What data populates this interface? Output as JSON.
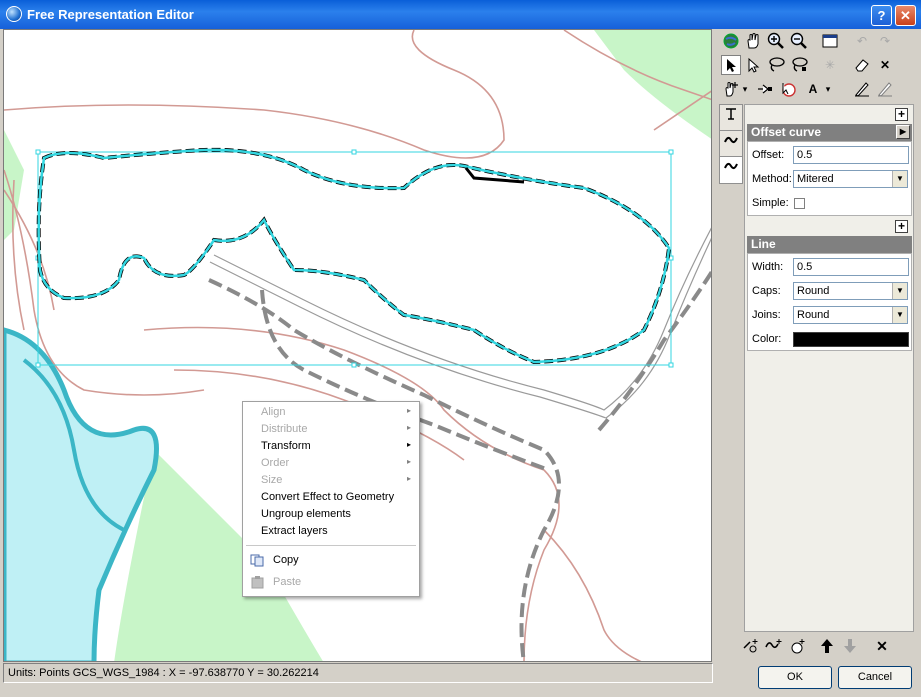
{
  "window": {
    "title": "Free Representation Editor",
    "help_label": "?",
    "close_label": "✕"
  },
  "context_menu": {
    "items": [
      {
        "label": "Align",
        "enabled": false,
        "submenu": true
      },
      {
        "label": "Distribute",
        "enabled": false,
        "submenu": true
      },
      {
        "label": "Transform",
        "enabled": true,
        "submenu": true
      },
      {
        "label": "Order",
        "enabled": false,
        "submenu": true
      },
      {
        "label": "Size",
        "enabled": false,
        "submenu": true
      },
      {
        "label": "Convert Effect to Geometry",
        "enabled": true,
        "submenu": false
      },
      {
        "label": "Ungroup elements",
        "enabled": true,
        "submenu": false
      },
      {
        "label": "Extract layers",
        "enabled": true,
        "submenu": false
      }
    ],
    "copy_label": "Copy",
    "paste_label": "Paste",
    "submenu_glyph": "▸"
  },
  "toolbar": {
    "row1": [
      "globe-icon",
      "pan-hand-icon",
      "zoom-in-icon",
      "zoom-out-icon",
      "full-extent-icon",
      "undo-icon",
      "redo-icon"
    ],
    "row2": [
      "select-arrow-icon",
      "direct-select-icon",
      "lasso-icon",
      "lasso-vertex-icon",
      "sparkle-icon",
      "eraser-icon",
      "delete-x-icon"
    ],
    "row3": [
      "add-vertex-icon",
      "dropdown-arrow-icon",
      "reshape-icon",
      "marker-icon",
      "text-a-icon",
      "dropdown-arrow-icon",
      "pen-icon",
      "pen-alt-icon"
    ],
    "glyphs": {
      "undo": "↶",
      "redo": "↷",
      "delete": "✕",
      "sparkle": "✳",
      "text": "A",
      "dropdown": "▾",
      "pointer": "➤",
      "hollow_pointer": "▷"
    }
  },
  "vtabs": [
    "layer-icon",
    "curve-icon",
    "curve-active-icon"
  ],
  "panel": {
    "offset_section": {
      "title": "Offset curve",
      "offset_label": "Offset:",
      "offset_value": "0.5",
      "method_label": "Method:",
      "method_value": "Mitered",
      "simple_label": "Simple:",
      "simple_checked": false
    },
    "line_section": {
      "title": "Line",
      "width_label": "Width:",
      "width_value": "0.5",
      "caps_label": "Caps:",
      "caps_value": "Round",
      "joins_label": "Joins:",
      "joins_value": "Round",
      "color_label": "Color:",
      "color_value": "#000000"
    },
    "plus_glyph": "+",
    "play_glyph": "▶",
    "dropdown_glyph": "▼"
  },
  "bottom_tools": {
    "icons": [
      "add-layer-icon",
      "add-effect-icon",
      "add-marker-icon",
      "move-up-icon",
      "move-down-icon",
      "remove-icon"
    ],
    "glyphs": {
      "up": "🡅",
      "down": "🡇",
      "remove": "✕"
    }
  },
  "status": {
    "text": "Units: Points   GCS_WGS_1984 :  X = -97.638770   Y = 30.262214"
  },
  "buttons": {
    "ok": "OK",
    "cancel": "Cancel"
  },
  "colors": {
    "selection": "#33d6e0",
    "contour": "#d29a94",
    "water": "#bff0f5",
    "water_edge": "#3bb6c6",
    "vegetation": "#c8f5c8",
    "road_dash": "#8a8a8a"
  }
}
